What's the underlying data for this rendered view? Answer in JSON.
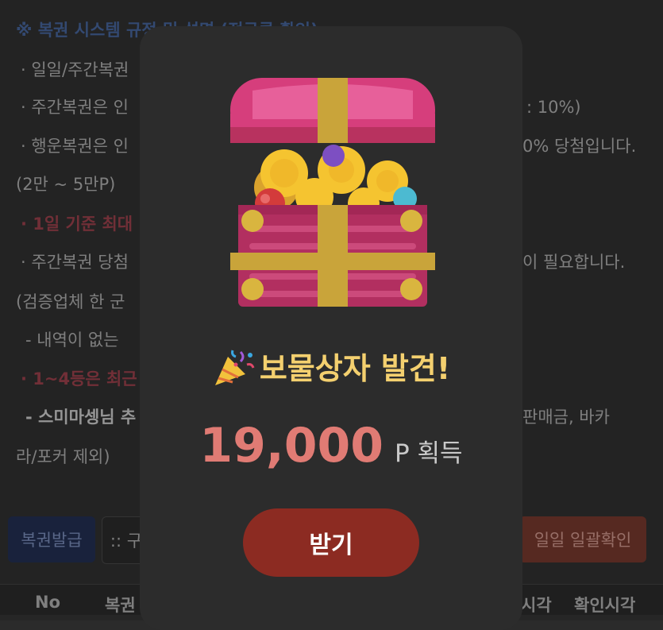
{
  "background": {
    "heading": "※ 복권 시스템 규정 및 설명 (전규큼 확인)",
    "lines": [
      "· 일일/주간복권",
      "· 주간복권은 인",
      "· 행운복권은 인",
      "(2만 ~ 5만P)",
      "· 1일 기준 최대",
      "· 주간복권 당첨",
      "(검증업체 한 군",
      "- 내역이 없는",
      "· 1~4등은 최근",
      "- 스미마셍님 추",
      "라/포커 제외)"
    ],
    "right_fragments": {
      "line2": ": 10%)",
      "line3": "0% 당첨입니다.",
      "line6": "이 필요합니다.",
      "line10": "판매금, 바카"
    },
    "buttons": {
      "issue": "복권발급",
      "select": ":: 구",
      "batch": "일일 일괄확인"
    },
    "table_headers": {
      "no": "No",
      "name": "복권",
      "time1": "시각",
      "time2": "확인시각"
    }
  },
  "modal": {
    "title": "보물상자 발견!",
    "amount": "19,000",
    "unit": "P 획득",
    "claim_label": "받기"
  },
  "colors": {
    "chest_pink": "#d63e7c",
    "chest_gold": "#c9a43a",
    "title_yellow": "#f4d06f",
    "amount_red": "#e07b74",
    "claim_button": "#8c2b22"
  }
}
